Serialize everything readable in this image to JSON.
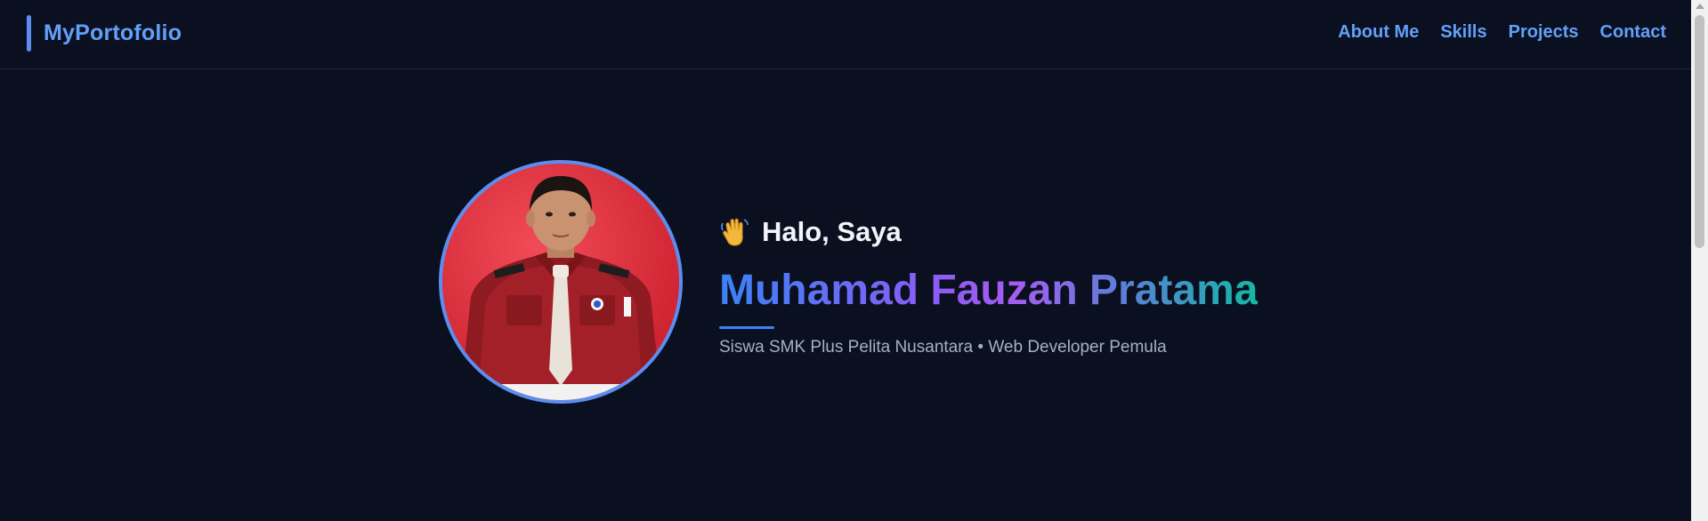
{
  "nav": {
    "brand": "MyPortofolio",
    "links": [
      "About Me",
      "Skills",
      "Projects",
      "Contact"
    ]
  },
  "hero": {
    "wave_icon": "waving-hand-icon",
    "greeting": "Halo, Saya",
    "name": "Muhamad Fauzan Pratama",
    "tagline": "Siswa SMK Plus Pelita Nusantara • Web Developer Pemula",
    "photo_icon": "profile-photo"
  },
  "colors": {
    "background": "#0b1020",
    "accent": "#5b8ef0",
    "link": "#62a0f8",
    "gradient_start": "#3b82f6",
    "gradient_mid": "#8b5cf6",
    "gradient_end": "#14b8a6"
  }
}
